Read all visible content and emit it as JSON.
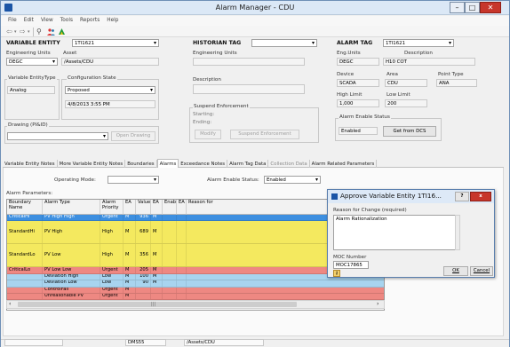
{
  "window": {
    "title": "Alarm Manager - CDU"
  },
  "menu": [
    "File",
    "Edit",
    "View",
    "Tools",
    "Reports",
    "Help"
  ],
  "toolbar": {
    "back_icon": "back-arrow-icon",
    "forward_icon": "forward-arrow-icon",
    "search_icon": "search-icon",
    "users_icon": "users-icon",
    "logo_icon": "app-logo-icon"
  },
  "variable_entity": {
    "label": "VARIABLE ENTITY",
    "tag": "1TI1621",
    "eng_units_label": "Engineering Units",
    "eng_units_value": "DEGC",
    "asset_label": "Asset",
    "asset_value": "/Assets/CDU",
    "type_label": "Variable EntityType",
    "type_value": "Analog",
    "config_state_label": "Configuration State",
    "config_state_value": "Proposed",
    "config_date": "4/8/2013 3:55 PM",
    "drawing_label": "Drawing (PI&ID)",
    "drawing_value": "",
    "open_drawing": "Open Drawing"
  },
  "historian_tag": {
    "label": "HISTORIAN TAG",
    "value": "",
    "eng_units_label": "Engineering Units",
    "eng_units_value": "",
    "description_label": "Description",
    "description_value": "",
    "suspend_label": "Suspend Enforcement",
    "starting_label": "Starting:",
    "ending_label": "Ending:",
    "modify": "Modify",
    "suspend_btn": "Suspend Enforcement"
  },
  "alarm_tag": {
    "label": "ALARM TAG",
    "value": "1TI1621",
    "eng_units_label": "Eng.Units",
    "eng_units_value": "DEGC",
    "description_label": "Description",
    "description_value": "H10 COT",
    "device_label": "Device",
    "device_value": "SCADA",
    "area_label": "Area",
    "area_value": "CDU",
    "point_type_label": "Point Type",
    "point_type_value": "ANA",
    "high_limit_label": "High Limit",
    "high_limit_value": "1,000",
    "low_limit_label": "Low Limit",
    "low_limit_value": "200",
    "enable_status_label": "Alarm Enable Status",
    "enable_status_value": "Enabled",
    "get_from_dcs": "Get from DCS"
  },
  "tabs": [
    {
      "label": "Variable Entity Notes",
      "muted": false,
      "active": false
    },
    {
      "label": "More Variable Entity Notes",
      "muted": false,
      "active": false
    },
    {
      "label": "Boundaries",
      "muted": false,
      "active": false
    },
    {
      "label": "Alarms",
      "muted": false,
      "active": true
    },
    {
      "label": "Exceedance Notes",
      "muted": false,
      "active": false
    },
    {
      "label": "Alarm Tag Data",
      "muted": false,
      "active": false
    },
    {
      "label": "Collection Data",
      "muted": true,
      "active": false
    },
    {
      "label": "Alarm Related Parameters",
      "muted": false,
      "active": false
    }
  ],
  "alarms_tab": {
    "operating_mode_label": "Operating Mode:",
    "operating_mode_value": "",
    "enable_status_label": "Alarm Enable Status:",
    "enable_status_value": "Enabled",
    "params_label": "Alarm Parameters:"
  },
  "grid": {
    "columns": [
      "Boundary Name",
      "Alarm Type",
      "Alarm Priority",
      "EA",
      "Value",
      "EA",
      "Enabled",
      "EA",
      "Reason for"
    ],
    "rows": [
      {
        "boundary": "CriticalHi",
        "type": "PV High High",
        "priority": "Urgent",
        "ea1": "M",
        "value": "936",
        "ea2": "M",
        "enabled": "",
        "ea3": "",
        "reason": "",
        "color": "#3d8fe0",
        "tall": false,
        "selected": true
      },
      {
        "boundary": "StandardHi",
        "type": "PV High",
        "priority": "High",
        "ea1": "M",
        "value": "689",
        "ea2": "M",
        "enabled": "",
        "ea3": "",
        "reason": "",
        "color": "#f4e95f",
        "tall": true
      },
      {
        "boundary": "StandardLo",
        "type": "PV Low",
        "priority": "High",
        "ea1": "M",
        "value": "356",
        "ea2": "M",
        "enabled": "",
        "ea3": "",
        "reason": "",
        "color": "#f4e95f",
        "tall": true
      },
      {
        "boundary": "CriticalLo",
        "type": "PV Low Low",
        "priority": "Urgent",
        "ea1": "M",
        "value": "205",
        "ea2": "M",
        "enabled": "",
        "ea3": "",
        "reason": "",
        "color": "#ee8882"
      },
      {
        "boundary": "",
        "type": "Deviation High",
        "priority": "Low",
        "ea1": "M",
        "value": "100",
        "ea2": "M",
        "enabled": "",
        "ea3": "",
        "reason": "",
        "color": "#a8d4ef"
      },
      {
        "boundary": "",
        "type": "Deviation Low",
        "priority": "Low",
        "ea1": "M",
        "value": "90",
        "ea2": "M",
        "enabled": "",
        "ea3": "",
        "reason": "",
        "color": "#a8d4ef"
      },
      {
        "boundary": "",
        "type": "ControlFail",
        "priority": "Urgent",
        "ea1": "M",
        "value": "",
        "ea2": "",
        "enabled": "",
        "ea3": "",
        "reason": "",
        "color": "#ee8882"
      },
      {
        "boundary": "",
        "type": "Unreasonable PV",
        "priority": "Urgent",
        "ea1": "M",
        "value": "",
        "ea2": "",
        "enabled": "",
        "ea3": "",
        "reason": "",
        "color": "#ee8882"
      }
    ]
  },
  "dialog": {
    "title": "Approve Variable Entity 1TI16...",
    "help": "?",
    "close": "x",
    "reason_label": "Reason for Change (required)",
    "reason_value": "Alarm Rationalization",
    "moc_label": "MOC Number",
    "moc_value": "MOC17865",
    "ok": "OK",
    "cancel": "Cancel"
  },
  "status_bar": {
    "left": "",
    "middle": "DMS55",
    "path": "/Assets/CDU"
  }
}
